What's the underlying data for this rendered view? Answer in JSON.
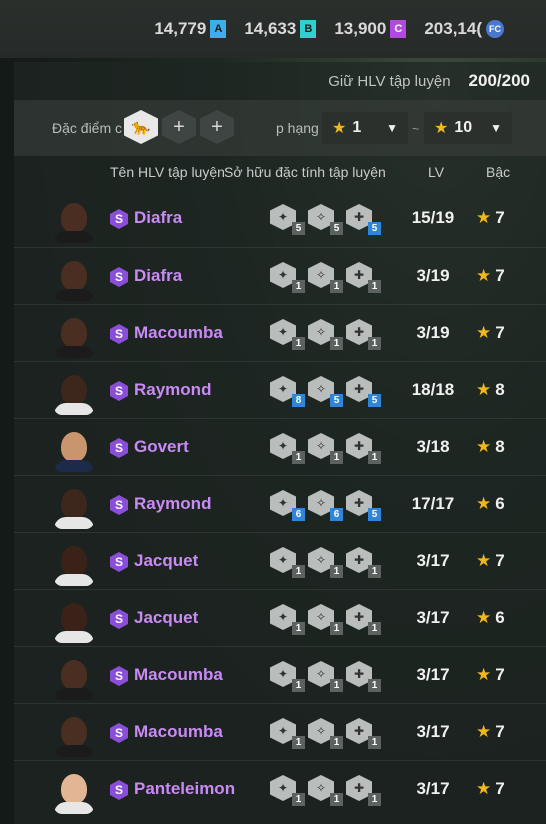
{
  "currencies": [
    {
      "value": "14,779",
      "icon": "A",
      "icon_name": "a-chip-icon"
    },
    {
      "value": "14,633",
      "icon": "B",
      "icon_name": "b-chip-icon"
    },
    {
      "value": "13,900",
      "icon": "C",
      "icon_name": "c-chip-icon"
    },
    {
      "value": "203,14(",
      "icon": "FC",
      "icon_name": "fc-coin-icon"
    }
  ],
  "keep": {
    "label": "Giữ HLV tập luyện",
    "value": "200/200"
  },
  "filter": {
    "trait_label": "Đặc điểm c",
    "rank_label": "p hạng",
    "rank_min": "1",
    "rank_max": "10",
    "tilde": "~"
  },
  "headers": {
    "name": "Tên HLV tập luyện",
    "trait": "Sở hữu đặc tính tập luyện",
    "lv": "LV",
    "rank": "Bậc"
  },
  "rows": [
    {
      "name": "Diafra",
      "lv": "15/19",
      "rank": "7",
      "skin": "#4a2e22",
      "shirt": "#1b1b1b",
      "traits": [
        {
          "lvl": "5",
          "blue": false
        },
        {
          "lvl": "5",
          "blue": false
        },
        {
          "lvl": "5",
          "blue": true
        }
      ]
    },
    {
      "name": "Diafra",
      "lv": "3/19",
      "rank": "7",
      "skin": "#4a2e22",
      "shirt": "#1b1b1b",
      "traits": [
        {
          "lvl": "1",
          "blue": false
        },
        {
          "lvl": "1",
          "blue": false
        },
        {
          "lvl": "1",
          "blue": false
        }
      ]
    },
    {
      "name": "Macoumba",
      "lv": "3/19",
      "rank": "7",
      "skin": "#4a2e22",
      "shirt": "#1b1b1b",
      "traits": [
        {
          "lvl": "1",
          "blue": false
        },
        {
          "lvl": "1",
          "blue": false
        },
        {
          "lvl": "1",
          "blue": false
        }
      ]
    },
    {
      "name": "Raymond",
      "lv": "18/18",
      "rank": "8",
      "skin": "#3d261c",
      "shirt": "#e6e6e6",
      "traits": [
        {
          "lvl": "8",
          "blue": true
        },
        {
          "lvl": "5",
          "blue": true
        },
        {
          "lvl": "5",
          "blue": true
        }
      ]
    },
    {
      "name": "Govert",
      "lv": "3/18",
      "rank": "8",
      "skin": "#c8956f",
      "shirt": "#1c2b4a",
      "traits": [
        {
          "lvl": "1",
          "blue": false
        },
        {
          "lvl": "1",
          "blue": false
        },
        {
          "lvl": "1",
          "blue": false
        }
      ]
    },
    {
      "name": "Raymond",
      "lv": "17/17",
      "rank": "6",
      "skin": "#3d261c",
      "shirt": "#e6e6e6",
      "traits": [
        {
          "lvl": "6",
          "blue": true
        },
        {
          "lvl": "6",
          "blue": true
        },
        {
          "lvl": "5",
          "blue": true
        }
      ]
    },
    {
      "name": "Jacquet",
      "lv": "3/17",
      "rank": "7",
      "skin": "#3a2219",
      "shirt": "#e6e6e6",
      "traits": [
        {
          "lvl": "1",
          "blue": false
        },
        {
          "lvl": "1",
          "blue": false
        },
        {
          "lvl": "1",
          "blue": false
        }
      ]
    },
    {
      "name": "Jacquet",
      "lv": "3/17",
      "rank": "6",
      "skin": "#3a2219",
      "shirt": "#e6e6e6",
      "traits": [
        {
          "lvl": "1",
          "blue": false
        },
        {
          "lvl": "1",
          "blue": false
        },
        {
          "lvl": "1",
          "blue": false
        }
      ]
    },
    {
      "name": "Macoumba",
      "lv": "3/17",
      "rank": "7",
      "skin": "#4a2e22",
      "shirt": "#1b1b1b",
      "traits": [
        {
          "lvl": "1",
          "blue": false
        },
        {
          "lvl": "1",
          "blue": false
        },
        {
          "lvl": "1",
          "blue": false
        }
      ]
    },
    {
      "name": "Macoumba",
      "lv": "3/17",
      "rank": "7",
      "skin": "#4a2e22",
      "shirt": "#1b1b1b",
      "traits": [
        {
          "lvl": "1",
          "blue": false
        },
        {
          "lvl": "1",
          "blue": false
        },
        {
          "lvl": "1",
          "blue": false
        }
      ]
    },
    {
      "name": "Panteleimon",
      "lv": "3/17",
      "rank": "7",
      "skin": "#e2b594",
      "shirt": "#e6e6e6",
      "traits": [
        {
          "lvl": "1",
          "blue": false
        },
        {
          "lvl": "1",
          "blue": false
        },
        {
          "lvl": "1",
          "blue": false
        }
      ]
    }
  ],
  "colors": {
    "accent_purple": "#c98af5",
    "star": "#f1b81e",
    "trait_blue": "#2f86d8"
  }
}
